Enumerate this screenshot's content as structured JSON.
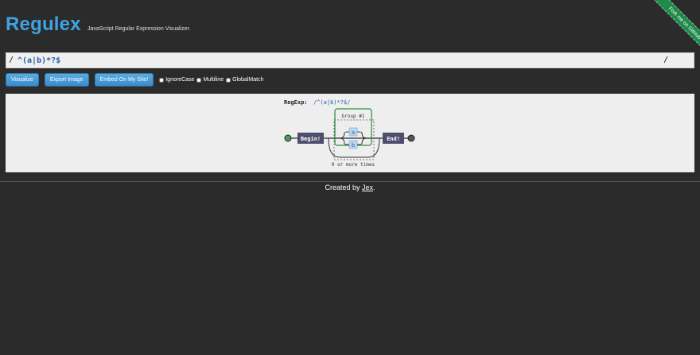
{
  "header": {
    "logo": "Regulex",
    "tagline": "JavaScript Regular Expression Visualizer.",
    "ribbon": "Fork me on GitHub"
  },
  "input": {
    "slash_left": "/",
    "value": "^(a|b)*?$",
    "slash_right": "/"
  },
  "toolbar": {
    "visualize": "Visualize",
    "export": "Export Image",
    "embed": "Embed On My Site!",
    "flags": [
      {
        "label": "IgnoreCase",
        "checked": false
      },
      {
        "label": "Multiline",
        "checked": false
      },
      {
        "label": "GlobalMatch",
        "checked": false
      }
    ]
  },
  "diagram": {
    "regexp_label": "RegExp:",
    "regexp_value": "/^(a|b)*?$/",
    "begin": "Begin!",
    "end": "End!",
    "group_label": "Group #1",
    "branch_a": "a",
    "branch_b": "b",
    "repeat_label": "0 or more times",
    "colors": {
      "node": "#4d4d6d",
      "group_border": "#2a8a3a",
      "literal_bg": "#bcd7f0",
      "literal_text": "#2a5caa",
      "start_dot": "#4a9a5a",
      "end_dot": "#555"
    }
  },
  "footer": {
    "prefix": "Created by ",
    "author": "Jex",
    "suffix": "."
  }
}
